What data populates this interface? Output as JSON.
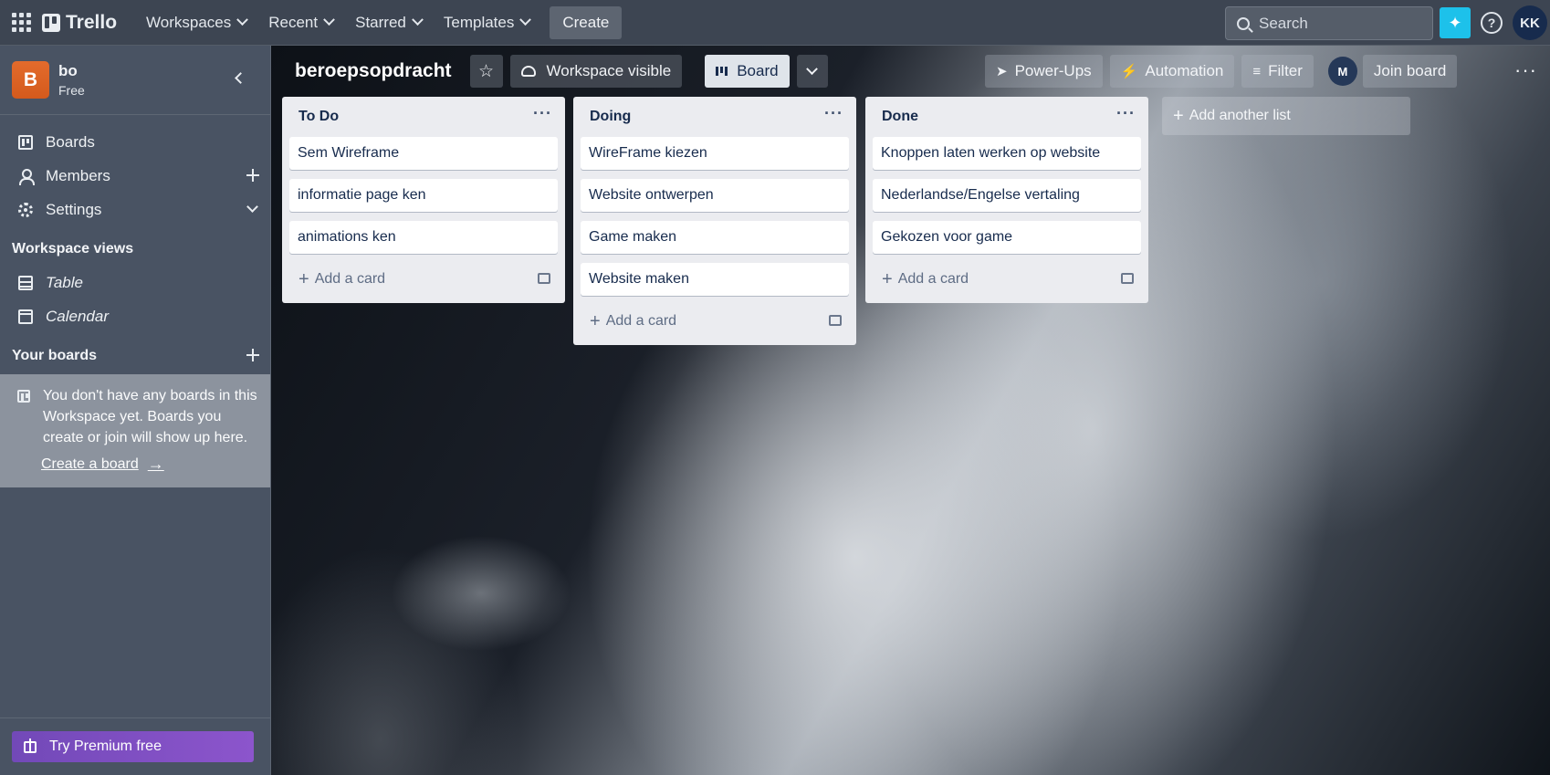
{
  "topbar": {
    "logo": "Trello",
    "nav": [
      "Workspaces",
      "Recent",
      "Starred",
      "Templates"
    ],
    "create": "Create",
    "search_placeholder": "Search",
    "user_initials": "KK"
  },
  "sidebar": {
    "workspace_initial": "B",
    "workspace_name": "bo",
    "workspace_plan": "Free",
    "items": [
      {
        "label": "Boards"
      },
      {
        "label": "Members"
      },
      {
        "label": "Settings"
      }
    ],
    "views_title": "Workspace views",
    "views": [
      {
        "label": "Table"
      },
      {
        "label": "Calendar"
      }
    ],
    "your_boards_title": "Your boards",
    "empty_text": "You don't have any boards in this Workspace yet. Boards you create or join will show up here.",
    "create_board": "Create a board",
    "premium": "Try Premium free"
  },
  "board": {
    "title": "beroepsopdracht",
    "visibility": "Workspace visible",
    "view": "Board",
    "power_ups": "Power-Ups",
    "automation": "Automation",
    "filter": "Filter",
    "member_initial": "M",
    "join": "Join board",
    "add_list": "Add another list",
    "add_card": "Add a card",
    "lists": [
      {
        "title": "To Do",
        "cards": [
          "Sem Wireframe",
          "informatie page ken",
          "animations ken"
        ]
      },
      {
        "title": "Doing",
        "cards": [
          "WireFrame kiezen",
          "Website ontwerpen",
          "Game maken",
          "Website maken"
        ]
      },
      {
        "title": "Done",
        "cards": [
          "Knoppen laten werken op website",
          "Nederlandse/Engelse vertaling",
          "Gekozen voor game"
        ]
      }
    ]
  }
}
